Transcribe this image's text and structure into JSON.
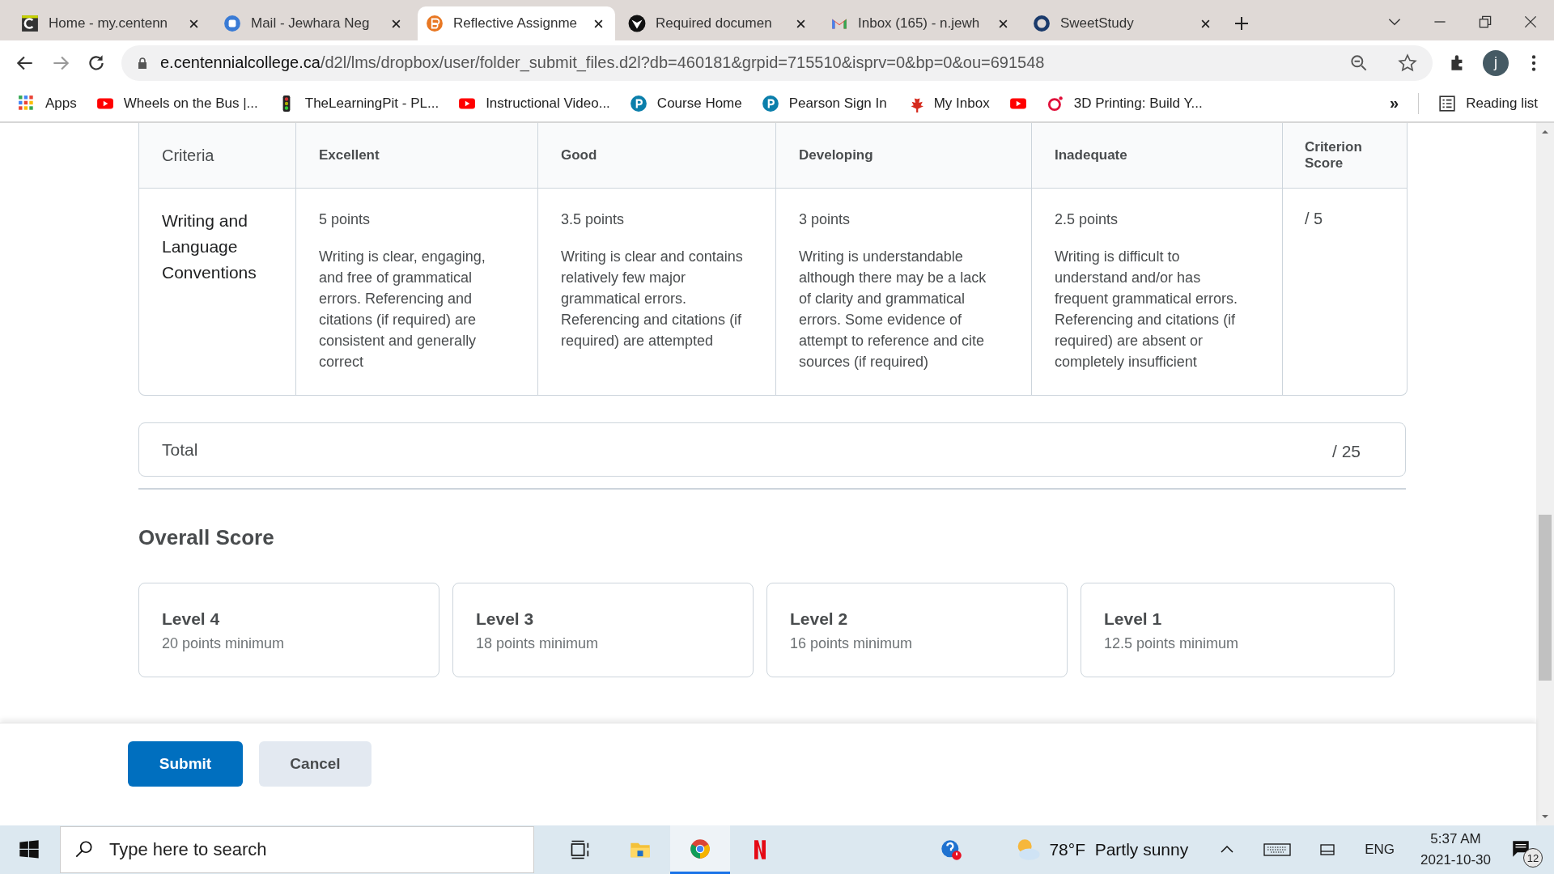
{
  "tabs": [
    {
      "title": "Home - my.centenn",
      "selected": false
    },
    {
      "title": "Mail - Jewhara Neg",
      "selected": false
    },
    {
      "title": "Reflective Assignme",
      "selected": true
    },
    {
      "title": "Required documen",
      "selected": false
    },
    {
      "title": "Inbox (165) - n.jewh",
      "selected": false
    },
    {
      "title": "SweetStudy",
      "selected": false
    }
  ],
  "address": {
    "host": "e.centennialcollege.ca",
    "path": "/d2l/lms/dropbox/user/folder_submit_files.d2l?db=460181&grpid=715510&isprv=0&bp=0&ou=691548"
  },
  "profile_initial": "j",
  "bookmarks": [
    {
      "label": "Apps"
    },
    {
      "label": "Wheels on the Bus |..."
    },
    {
      "label": "TheLearningPit - PL..."
    },
    {
      "label": "Instructional Video..."
    },
    {
      "label": "Course Home"
    },
    {
      "label": "Pearson Sign In"
    },
    {
      "label": "My Inbox"
    },
    {
      "label": "3D Printing: Build Y..."
    }
  ],
  "bookmarks_overflow": "»",
  "reading_list": "Reading list",
  "rubric": {
    "columns": [
      "Criteria",
      "Excellent",
      "Good",
      "Developing",
      "Inadequate",
      "Criterion Score"
    ],
    "rows": [
      {
        "criterion": "Writing and Language Conventions",
        "levels": [
          {
            "points": "5 points",
            "description": "Writing is clear, engaging, and free of grammatical errors. Referencing and citations (if required) are consistent and generally correct"
          },
          {
            "points": "3.5 points",
            "description": "Writing is clear and contains relatively few major grammatical errors. Referencing and citations (if required) are attempted"
          },
          {
            "points": "3 points",
            "description": "Writing is understandable although there may be a lack of clarity and grammatical errors. Some evidence of attempt to reference and cite sources (if required)"
          },
          {
            "points": "2.5 points",
            "description": "Writing is difficult to understand and/or has frequent grammatical errors. Referencing and citations (if required) are absent or completely insufficient"
          }
        ],
        "score": "/ 5"
      }
    ],
    "total_label": "Total",
    "total_score": "/ 25"
  },
  "overall": {
    "title": "Overall Score",
    "levels": [
      {
        "name": "Level 4",
        "minimum": "20 points minimum"
      },
      {
        "name": "Level 3",
        "minimum": "18 points minimum"
      },
      {
        "name": "Level 2",
        "minimum": "16 points minimum"
      },
      {
        "name": "Level 1",
        "minimum": "12.5 points minimum"
      }
    ]
  },
  "buttons": [
    {
      "label": "Submit",
      "kind": "primary"
    },
    {
      "label": "Cancel",
      "kind": "secondary"
    }
  ],
  "taskbar": {
    "search_placeholder": "Type here to search",
    "weather": "78°F  Partly sunny",
    "language": "ENG",
    "time": "5:37 AM",
    "date": "2021-10-30",
    "notifications": "12"
  }
}
